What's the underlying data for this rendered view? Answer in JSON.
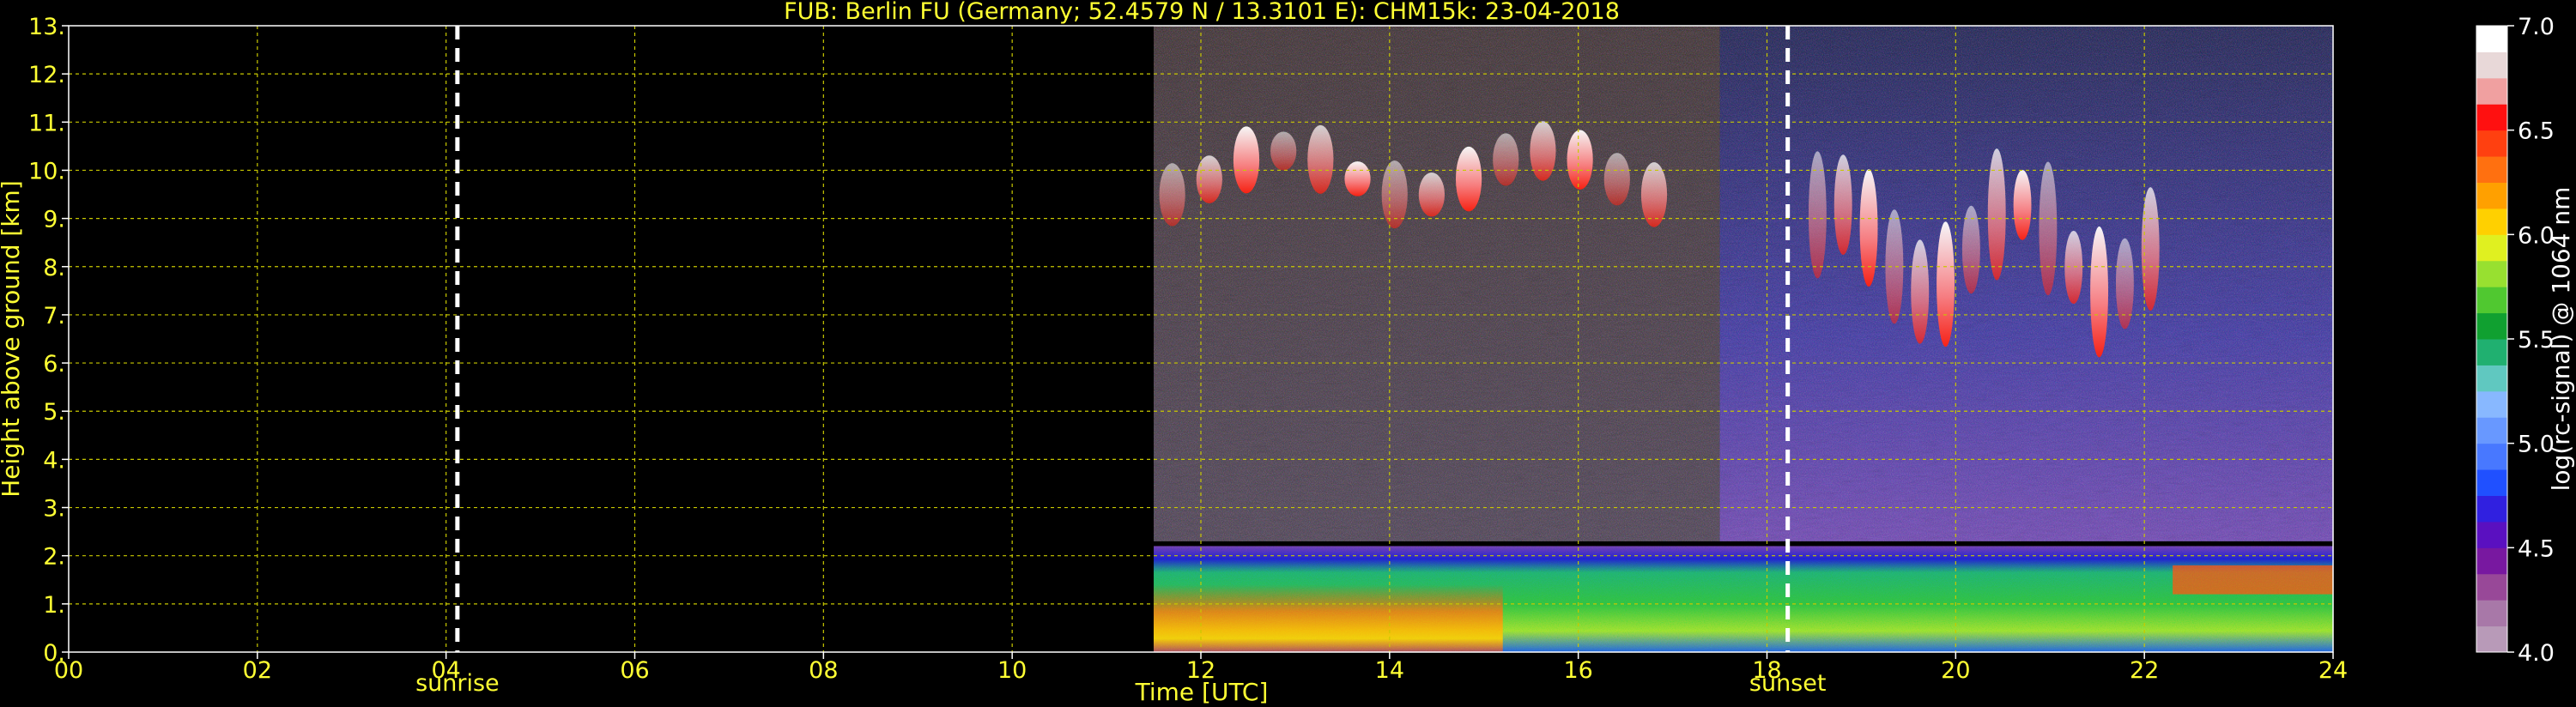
{
  "chart_data": {
    "type": "heatmap",
    "title": "FUB: Berlin FU (Germany; 52.4579 N / 13.3101 E):    CHM15k: 23-04-2018",
    "xlabel": "Time [UTC]",
    "ylabel": "Height above ground [km]",
    "xlim": [
      0,
      24
    ],
    "ylim": [
      0,
      13
    ],
    "x_ticks": [
      "00",
      "02",
      "04",
      "06",
      "08",
      "10",
      "12",
      "14",
      "16",
      "18",
      "20",
      "22",
      "24"
    ],
    "y_ticks": [
      "0.",
      "1.",
      "2.",
      "3.",
      "4.",
      "5.",
      "6.",
      "7.",
      "8.",
      "9.",
      "10.",
      "11.",
      "12.",
      "13."
    ],
    "grid": true,
    "data_start_hour": 11.5,
    "markers": [
      {
        "label": "sunrise",
        "hour": 4.12
      },
      {
        "label": "sunset",
        "hour": 18.22
      }
    ],
    "layers": [
      {
        "description": "boundary layer aerosol",
        "from_hour": 11.5,
        "to_hour": 24,
        "bottom_km": 0.0,
        "top_km": 2.2,
        "level": 5.6
      },
      {
        "description": "high cirrus",
        "from_hour": 11.5,
        "to_hour": 17.0,
        "bottom_km": 8.5,
        "top_km": 10.4,
        "level": 6.5
      },
      {
        "description": "cirrus",
        "from_hour": 18.4,
        "to_hour": 22.2,
        "bottom_km": 5.6,
        "top_km": 9.3,
        "level": 6.3
      }
    ],
    "colorbar": {
      "label": "log(rc-signal) @ 1064 nm",
      "range": [
        4.0,
        7.0
      ],
      "ticks": [
        "4.0",
        "4.5",
        "5.0",
        "5.5",
        "6.0",
        "6.5",
        "7.0"
      ],
      "colors": [
        "#b89ab8",
        "#a878a8",
        "#984898",
        "#7818a0",
        "#5a10c0",
        "#3020e0",
        "#2050ff",
        "#4878ff",
        "#6898ff",
        "#88b8ff",
        "#60c8c0",
        "#20b070",
        "#10a030",
        "#50c830",
        "#98e030",
        "#e0f020",
        "#ffd000",
        "#ffa000",
        "#ff7010",
        "#ff4010",
        "#ff1010",
        "#f0a0a0",
        "#e8d8d8",
        "#ffffff"
      ]
    }
  }
}
